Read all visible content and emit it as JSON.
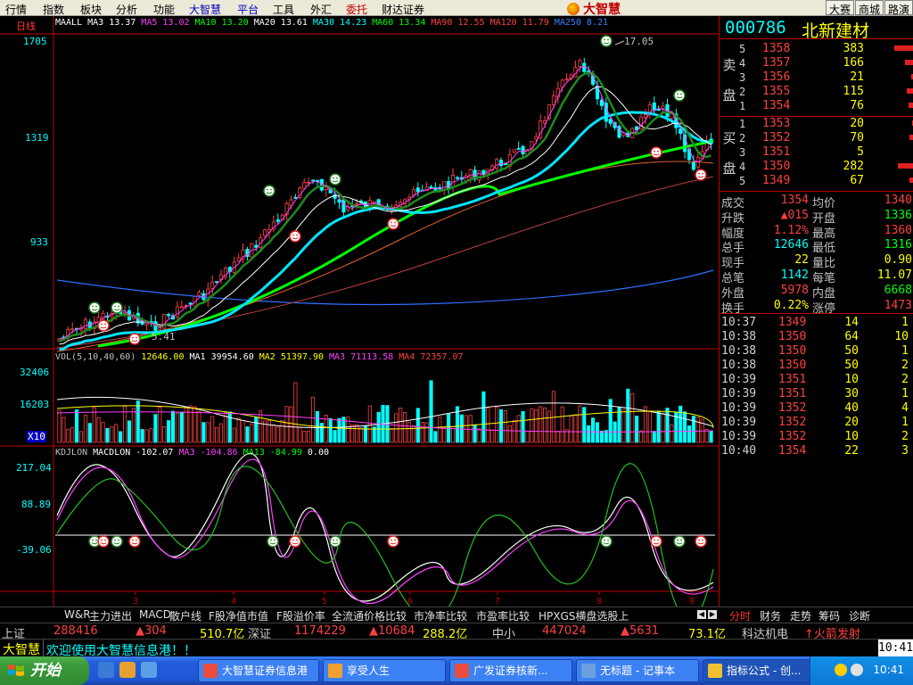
{
  "menu": {
    "items": [
      {
        "label": "行情",
        "style": ""
      },
      {
        "label": "指数",
        "style": ""
      },
      {
        "label": "板块",
        "style": ""
      },
      {
        "label": "分析",
        "style": ""
      },
      {
        "label": "功能",
        "style": ""
      },
      {
        "label": "大智慧",
        "style": "hl"
      },
      {
        "label": "平台",
        "style": "hl"
      },
      {
        "label": "工具",
        "style": ""
      },
      {
        "label": "外汇",
        "style": ""
      },
      {
        "label": "委托",
        "style": "red"
      },
      {
        "label": "财达证券",
        "style": ""
      }
    ],
    "brand": "大智慧",
    "right_buttons": [
      "大赛",
      "商城",
      "路演"
    ]
  },
  "chart": {
    "period_label": "日线",
    "price_axis": [
      "1705",
      "1319",
      "933"
    ],
    "vol_axis": [
      "32406",
      "16203",
      "X10"
    ],
    "macd_axis": [
      "217.04",
      "88.89",
      "-39.06"
    ],
    "price_legend": [
      {
        "text": "MAALL",
        "color": "#ffffff"
      },
      {
        "text": "MA3 13.37",
        "color": "#ffffff"
      },
      {
        "text": "MA5 13.02",
        "color": "#ff40ff"
      },
      {
        "text": "MA10 13.20",
        "color": "#00ff00"
      },
      {
        "text": "MA20 13.61",
        "color": "#ffffff"
      },
      {
        "text": "MA30 14.23",
        "color": "#00ffff"
      },
      {
        "text": "MA60 13.34",
        "color": "#00ff00"
      },
      {
        "text": "MA90 12.55",
        "color": "#ff4040"
      },
      {
        "text": "MA120 11.79",
        "color": "#ff4040"
      },
      {
        "text": "MA250 8.21",
        "color": "#4080ff"
      }
    ],
    "vol_legend": [
      {
        "text": "VOL(5,10,40,60)",
        "color": "#c0c0c0"
      },
      {
        "text": "12646.00",
        "color": "#ffff00"
      },
      {
        "text": "MA1 39954.60",
        "color": "#ffffff"
      },
      {
        "text": "MA2 51397.90",
        "color": "#ffff00"
      },
      {
        "text": "MA3 71113.58",
        "color": "#ff40ff"
      },
      {
        "text": "MA4 72357.07",
        "color": "#ff4040"
      }
    ],
    "macd_legend": [
      {
        "text": "KDJLON",
        "color": "#c0c0c0"
      },
      {
        "text": "MACDLON -102.07",
        "color": "#ffffff"
      },
      {
        "text": "MA3 -104.86",
        "color": "#ff40ff"
      },
      {
        "text": "MA13 -84.99",
        "color": "#00ff00"
      },
      {
        "text": "0.00",
        "color": "#ffffff"
      }
    ],
    "annotations": {
      "high": "17.05",
      "low": "5.41"
    },
    "x_ticks": [
      "3",
      "4",
      "5",
      "6",
      "7",
      "8",
      "9"
    ]
  },
  "quote": {
    "code": "000786",
    "name": "北新建材",
    "sell_label": [
      "卖",
      "盘"
    ],
    "buy_label": [
      "买",
      "盘"
    ],
    "sell": [
      {
        "lv": "5",
        "price": "1358",
        "vol": "383",
        "bar": 22
      },
      {
        "lv": "4",
        "price": "1357",
        "vol": "166",
        "bar": 10
      },
      {
        "lv": "3",
        "price": "1356",
        "vol": "21",
        "bar": 3
      },
      {
        "lv": "2",
        "price": "1355",
        "vol": "115",
        "bar": 8
      },
      {
        "lv": "1",
        "price": "1354",
        "vol": "76",
        "bar": 6
      }
    ],
    "buy": [
      {
        "lv": "1",
        "price": "1353",
        "vol": "20",
        "bar": 2
      },
      {
        "lv": "2",
        "price": "1352",
        "vol": "70",
        "bar": 5
      },
      {
        "lv": "3",
        "price": "1351",
        "vol": "5",
        "bar": 1
      },
      {
        "lv": "4",
        "price": "1350",
        "vol": "282",
        "bar": 18
      },
      {
        "lv": "5",
        "price": "1349",
        "vol": "67",
        "bar": 5
      }
    ],
    "stats": [
      {
        "k1": "成交",
        "v1": "1354",
        "c1": "#ff4040",
        "k2": "均价",
        "v2": "1340",
        "c2": "#ff4040"
      },
      {
        "k1": "升跌",
        "v1": "▲015",
        "c1": "#ff4040",
        "k2": "开盘",
        "v2": "1336",
        "c2": "#00ff00"
      },
      {
        "k1": "幅度",
        "v1": "1.12%",
        "c1": "#ff4040",
        "k2": "最高",
        "v2": "1360",
        "c2": "#ff4040"
      },
      {
        "k1": "总手",
        "v1": "12646",
        "c1": "#00ffff",
        "k2": "最低",
        "v2": "1316",
        "c2": "#00ff00"
      },
      {
        "k1": "现手",
        "v1": "22",
        "c1": "#ffff00",
        "k2": "量比",
        "v2": "0.90",
        "c2": "#ffff00"
      },
      {
        "k1": "总笔",
        "v1": "1142",
        "c1": "#00ffff",
        "k2": "每笔",
        "v2": "11.07",
        "c2": "#ffff00"
      },
      {
        "k1": "外盘",
        "v1": "5978",
        "c1": "#ff4040",
        "k2": "内盘",
        "v2": "6668",
        "c2": "#00ff00"
      },
      {
        "k1": "换手",
        "v1": "0.22%",
        "c1": "#ffff00",
        "k2": "涨停",
        "v2": "1473",
        "c2": "#ff4040"
      }
    ],
    "ticks": [
      {
        "t": "10:37",
        "p": "1349",
        "v": "14",
        "n": "1"
      },
      {
        "t": "10:38",
        "p": "1350",
        "v": "64",
        "n": "10"
      },
      {
        "t": "10:38",
        "p": "1350",
        "v": "50",
        "n": "1"
      },
      {
        "t": "10:38",
        "p": "1350",
        "v": "50",
        "n": "2"
      },
      {
        "t": "10:39",
        "p": "1351",
        "v": "10",
        "n": "2"
      },
      {
        "t": "10:39",
        "p": "1351",
        "v": "30",
        "n": "1"
      },
      {
        "t": "10:39",
        "p": "1352",
        "v": "40",
        "n": "4"
      },
      {
        "t": "10:39",
        "p": "1352",
        "v": "20",
        "n": "1"
      },
      {
        "t": "10:39",
        "p": "1352",
        "v": "10",
        "n": "2"
      },
      {
        "t": "10:40",
        "p": "1354",
        "v": "22",
        "n": "3"
      }
    ]
  },
  "tabs": {
    "left": [
      "W&R",
      "主力进出",
      "MACD",
      "散户线",
      "F股净值市值",
      "F股溢价率",
      "全流通价格比较",
      "市净率比较",
      "市盈率比较",
      "HPXGS横盘选股上"
    ],
    "right": [
      "分时",
      "财务",
      "走势",
      "筹码",
      "诊断"
    ],
    "active_right": "分时"
  },
  "index_strip": [
    {
      "text": "上证",
      "color": "#d0d0d0"
    },
    {
      "text": "288416",
      "color": "#ff4040"
    },
    {
      "text": "▲304",
      "color": "#ff4040"
    },
    {
      "text": "510.7亿",
      "color": "#ffff00"
    },
    {
      "text": "深证",
      "color": "#d0d0d0"
    },
    {
      "text": "1174229",
      "color": "#ff4040"
    },
    {
      "text": "▲10684",
      "color": "#ff4040"
    },
    {
      "text": "288.2亿",
      "color": "#ffff00"
    },
    {
      "text": "中小",
      "color": "#d0d0d0"
    },
    {
      "text": "447024",
      "color": "#ff4040"
    },
    {
      "text": "▲5631",
      "color": "#ff4040"
    },
    {
      "text": "73.1亿",
      "color": "#ffff00"
    },
    {
      "text": "科达机电",
      "color": "#d0d0d0"
    },
    {
      "text": "↑火箭发射",
      "color": "#ff4040"
    }
  ],
  "info": {
    "brand": "大智慧",
    "message": "欢迎使用大智慧信息港！！",
    "time": "10:41"
  },
  "taskbar": {
    "start_label": "开始",
    "buttons": [
      {
        "label": "大智慧证券信息港",
        "active": false
      },
      {
        "label": "享受人生",
        "active": false
      },
      {
        "label": "广发证券核新...",
        "active": false
      },
      {
        "label": "无标题 - 记事本",
        "active": false
      },
      {
        "label": "指标公式 - 创...",
        "active": true
      }
    ],
    "clock": "10:41"
  },
  "colors": {
    "up": "#ff4040",
    "down": "#00ffff",
    "ma30": "#00e5ff",
    "ma60": "#00ff00",
    "ma250": "#2f6fff"
  }
}
